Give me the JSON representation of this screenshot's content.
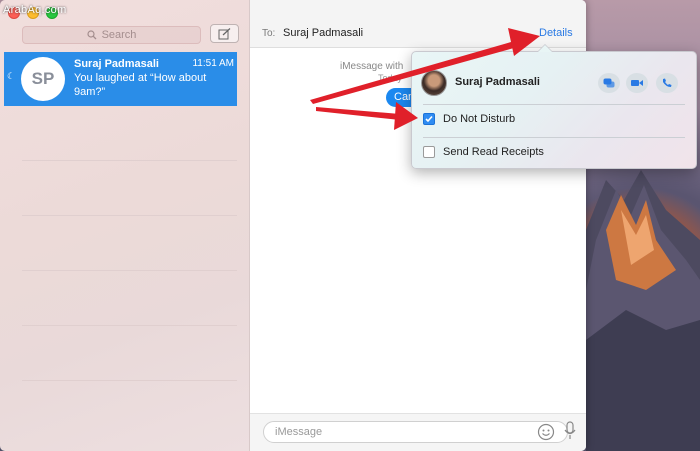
{
  "watermark": "ArabAq.com",
  "sidebar": {
    "search_placeholder": "Search",
    "conversation": {
      "initials": "SP",
      "name": "Suraj Padmasali",
      "time": "11:51 AM",
      "preview": "You laughed at “How about 9am?”"
    }
  },
  "header": {
    "to_label": "To:",
    "recipient": "Suraj Padmasali",
    "details_label": "Details"
  },
  "thread": {
    "service_info": "iMessage with",
    "date_label": "Today",
    "bubble_text": "Can"
  },
  "composer": {
    "placeholder": "iMessage"
  },
  "details_popover": {
    "contact_name": "Suraj Padmasali",
    "do_not_disturb_label": "Do Not Disturb",
    "do_not_disturb_checked": true,
    "read_receipts_label": "Send Read Receipts",
    "read_receipts_checked": false,
    "actions": [
      "message-icon",
      "video-call-icon",
      "phone-icon"
    ]
  },
  "colors": {
    "accent": "#2a8de8",
    "annotation_arrow": "#e0202a"
  }
}
